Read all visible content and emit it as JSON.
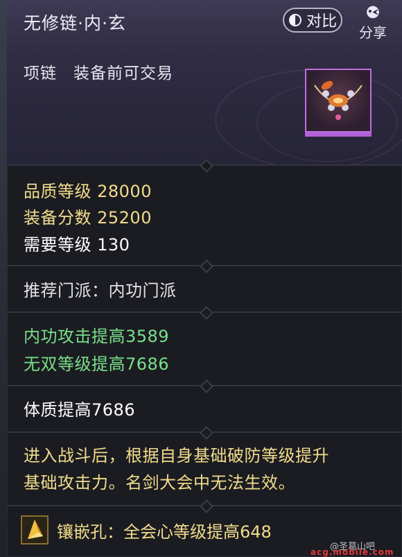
{
  "header": {
    "title": "无修链·内·玄",
    "compare_label": "对比",
    "share_label": "分享",
    "subtitle": "项链　装备前可交易"
  },
  "stats": {
    "quality_level": "品质等级 28000",
    "equip_score": "装备分数 25200",
    "required_level": "需要等级 130"
  },
  "recommend": "推荐门派：内功门派",
  "bonuses": [
    "内功攻击提高3589",
    "无双等级提高7686"
  ],
  "constitution": "体质提高7686",
  "effect_text": [
    "进入战斗后，根据自身基础破防等级提升",
    "基础攻击力。名剑大会中无法生效。"
  ],
  "socket": {
    "label": "镶嵌孔：全会心等级提高648",
    "icon": "gem-icon"
  },
  "watermark": {
    "text": "@圣葛山吧",
    "url": "acg.mobile.com"
  },
  "colors": {
    "stat_yellow": "#f2dc8c",
    "bonus_green": "#78e08a",
    "item_frame": "#c06fe0",
    "header_bg": "#2f2c44"
  }
}
